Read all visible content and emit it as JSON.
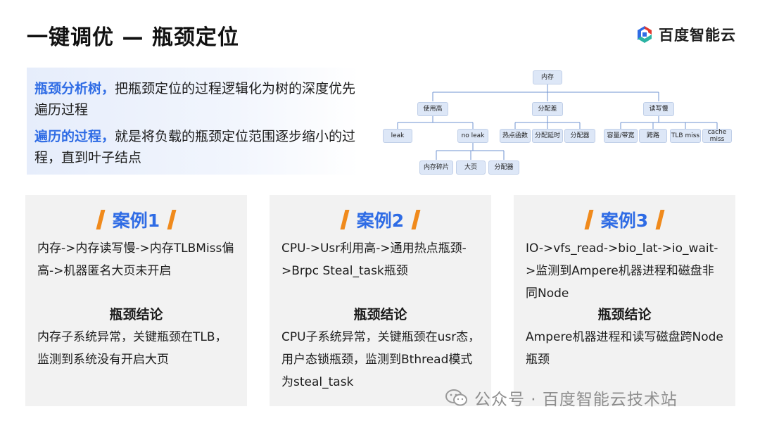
{
  "title": "一键调优 — 瓶颈定位",
  "brand": {
    "name": "百度智能云",
    "logo_icon": "baidu-cloud-logo-icon"
  },
  "intro": {
    "line1_highlight": "瓶颈分析树，",
    "line1_text": "把瓶颈定位的过程逻辑化为树的深度优先遍历过程",
    "line2_highlight": "遍历的过程，",
    "line2_text": "就是将负载的瓶颈定位范围逐步缩小的过程，直到叶子结点"
  },
  "tree": {
    "root": "内存",
    "level1": [
      "使用高",
      "分配差",
      "读写慢"
    ],
    "usage": [
      "leak",
      "no leak"
    ],
    "alloc": [
      "热点函数",
      "分配延时",
      "分配器"
    ],
    "rw": [
      "容量/带宽",
      "跨路",
      "TLB miss",
      "cache miss"
    ],
    "noleak": [
      "内存碎片",
      "大页",
      "分配器"
    ]
  },
  "cards": [
    {
      "title": "案例1",
      "body": "内存->内存读写慢->内存TLBMiss偏高->机器匿名大页未开启",
      "conclusion_title": "瓶颈结论",
      "conclusion": "内存子系统异常，关键瓶颈在TLB，监测到系统没有开启大页"
    },
    {
      "title": "案例2",
      "body": "CPU->Usr利用高->通用热点瓶颈->Brpc Steal_task瓶颈",
      "conclusion_title": "瓶颈结论",
      "conclusion": "CPU子系统异常，关键瓶颈在usr态，用户态锁瓶颈，监测到Bthread模式为steal_task"
    },
    {
      "title": "案例3",
      "body": "IO->vfs_read->bio_lat->io_wait->监测到Ampere机器进程和磁盘非同Node",
      "conclusion_title": "瓶颈结论",
      "conclusion": "Ampere机器进程和读写磁盘跨Node瓶颈"
    }
  ],
  "watermark": "公众号 · 百度智能云技术站",
  "colors": {
    "accent_blue": "#2f6ce5",
    "accent_orange": "#f08a1c",
    "node_fill": "#dde7f7",
    "card_bg": "#f2f2f2"
  }
}
